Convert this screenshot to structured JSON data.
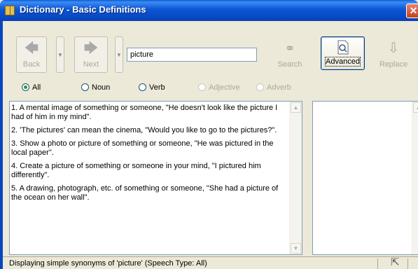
{
  "window": {
    "title": "Dictionary - Basic Definitions",
    "close_glyph": "✕"
  },
  "toolbar": {
    "back_label": "Back",
    "next_label": "Next",
    "search_value": "picture",
    "search_label": "Search",
    "advanced_label": "Advanced",
    "replace_label": "Replace"
  },
  "filters": [
    {
      "label": "All",
      "checked": true,
      "enabled": true
    },
    {
      "label": "Noun",
      "checked": false,
      "enabled": true
    },
    {
      "label": "Verb",
      "checked": false,
      "enabled": true
    },
    {
      "label": "Adjective",
      "checked": false,
      "enabled": false
    },
    {
      "label": "Adverb",
      "checked": false,
      "enabled": false
    }
  ],
  "definitions": [
    "1. A mental image of something or someone, \"He doesn't look like the picture I had of him in my mind\".",
    "2. 'The pictures' can mean the cinema, \"Would you like to go to the pictures?\".",
    "3. Show a photo or picture of something or someone, \"He was pictured in the local paper\".",
    "4. Create a picture of something or someone in your mind, \"I pictured him differently\".",
    "5. A drawing, photograph, etc. of something or someone, \"She had a picture of the ocean on her wall\"."
  ],
  "status": {
    "text": "Displaying simple synonyms of 'picture' (Speech Type: All)"
  },
  "icons": {
    "back": "arrow-left-icon",
    "next": "arrow-right-icon",
    "search": "binoculars-icon",
    "advanced": "magnifier-document-icon",
    "replace": "replace-icon",
    "book": "book-icon"
  }
}
